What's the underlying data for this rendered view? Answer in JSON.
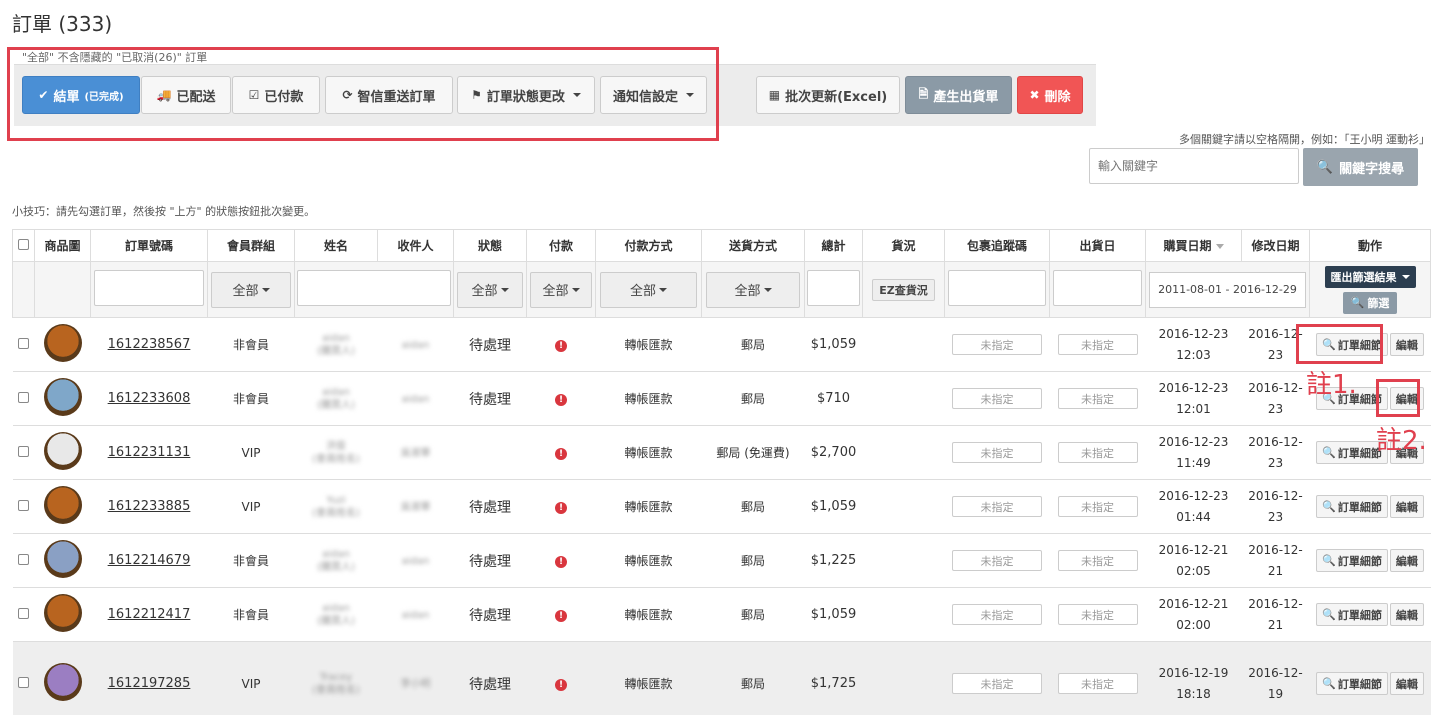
{
  "page": {
    "title": "訂單 (333)",
    "hint": "\"全部\" 不含隱藏的 \"已取消(26)\" 訂單",
    "tip": "小技巧：請先勾選訂單，然後按 \"上方\" 的狀態按鈕批次變更。"
  },
  "toolbar": {
    "complete_label": "結單",
    "complete_sub": "(已完成)",
    "shipped_label": "已配送",
    "paid_label": "已付款",
    "resend_label": "智信重送訂單",
    "status_change_label": "訂單狀態更改",
    "notify_label": "通知信設定",
    "batch_excel_label": "批次更新(Excel)",
    "gen_shipping_label": "產生出貨單",
    "delete_label": "刪除"
  },
  "search": {
    "note": "多個關鍵字請以空格隔開，例如：「王小明 運動衫」",
    "placeholder": "輸入關鍵字",
    "button_label": "關鍵字搜尋"
  },
  "table": {
    "headers": [
      "",
      "商品圖",
      "訂單號碼",
      "會員群組",
      "姓名",
      "收件人",
      "狀態",
      "付款",
      "付款方式",
      "送貨方式",
      "總計",
      "貨況",
      "包裹追蹤碼",
      "出貨日",
      "購買日期",
      "修改日期",
      "動作"
    ],
    "filters": {
      "all_label": "全部",
      "ez_label": "EZ查貨況",
      "date_range": "2011-08-01 - 2016-12-29",
      "export_label": "匯出篩選結果",
      "filter_label": "篩選"
    },
    "unassigned_label": "未指定",
    "detail_label": "訂單細節",
    "edit_label": "編輯",
    "rows": [
      {
        "order": "1612238567",
        "group": "非會員",
        "name1": "aidan",
        "name2": "(購買人)",
        "recipient": "aidan",
        "status": "待處理",
        "pay_method": "轉帳匯款",
        "ship": "郵局",
        "total": "$1,059",
        "buy_date": "2016-12-23",
        "buy_time": "12:03",
        "mod_date1": "2016-12-",
        "mod_date2": "23",
        "avatar_color": "#b8641f"
      },
      {
        "order": "1612233608",
        "group": "非會員",
        "name1": "aidan",
        "name2": "(購買人)",
        "recipient": "aidan",
        "status": "待處理",
        "pay_method": "轉帳匯款",
        "ship": "郵局",
        "total": "$710",
        "buy_date": "2016-12-23",
        "buy_time": "12:01",
        "mod_date1": "2016-12-",
        "mod_date2": "23",
        "avatar_color": "#7fa7c9"
      },
      {
        "order": "1612231131",
        "group": "VIP",
        "name1": "洪俊",
        "name2": "(會員姓名)",
        "recipient": "吳淑華",
        "status": "",
        "pay_method": "轉帳匯款",
        "ship": "郵局 (免運費)",
        "total": "$2,700",
        "buy_date": "2016-12-23",
        "buy_time": "11:49",
        "mod_date1": "2016-12-",
        "mod_date2": "23",
        "avatar_color": "#e8e8e8"
      },
      {
        "order": "1612233885",
        "group": "VIP",
        "name1": "Yuzi",
        "name2": "(會員姓名)",
        "recipient": "吳淑華",
        "status": "待處理",
        "pay_method": "轉帳匯款",
        "ship": "郵局",
        "total": "$1,059",
        "buy_date": "2016-12-23",
        "buy_time": "01:44",
        "mod_date1": "2016-12-",
        "mod_date2": "23",
        "avatar_color": "#b8641f"
      },
      {
        "order": "1612214679",
        "group": "非會員",
        "name1": "aidan",
        "name2": "(購買人)",
        "recipient": "aidan",
        "status": "待處理",
        "pay_method": "轉帳匯款",
        "ship": "郵局",
        "total": "$1,225",
        "buy_date": "2016-12-21",
        "buy_time": "02:05",
        "mod_date1": "2016-12-",
        "mod_date2": "21",
        "avatar_color": "#8aa0c4"
      },
      {
        "order": "1612212417",
        "group": "非會員",
        "name1": "aidan",
        "name2": "(購買人)",
        "recipient": "aidan",
        "status": "待處理",
        "pay_method": "轉帳匯款",
        "ship": "郵局",
        "total": "$1,059",
        "buy_date": "2016-12-21",
        "buy_time": "02:00",
        "mod_date1": "2016-12-",
        "mod_date2": "21",
        "avatar_color": "#b8641f"
      },
      {
        "order": "1612197285",
        "group": "VIP",
        "name1": "Tracey",
        "name2": "(會員姓名)",
        "recipient": "李小明",
        "status": "待處理",
        "pay_method": "轉帳匯款",
        "ship": "郵局",
        "total": "$1,725",
        "buy_date": "2016-12-19",
        "buy_time": "18:18",
        "mod_date1": "2016-12-",
        "mod_date2": "19",
        "avatar_color": "#9b7ec2"
      }
    ]
  },
  "annotations": {
    "note1": "註1.",
    "note2": "註2."
  },
  "colors": {
    "primary": "#4a8fd5",
    "danger": "#f15555",
    "annotation": "#e0404e"
  }
}
